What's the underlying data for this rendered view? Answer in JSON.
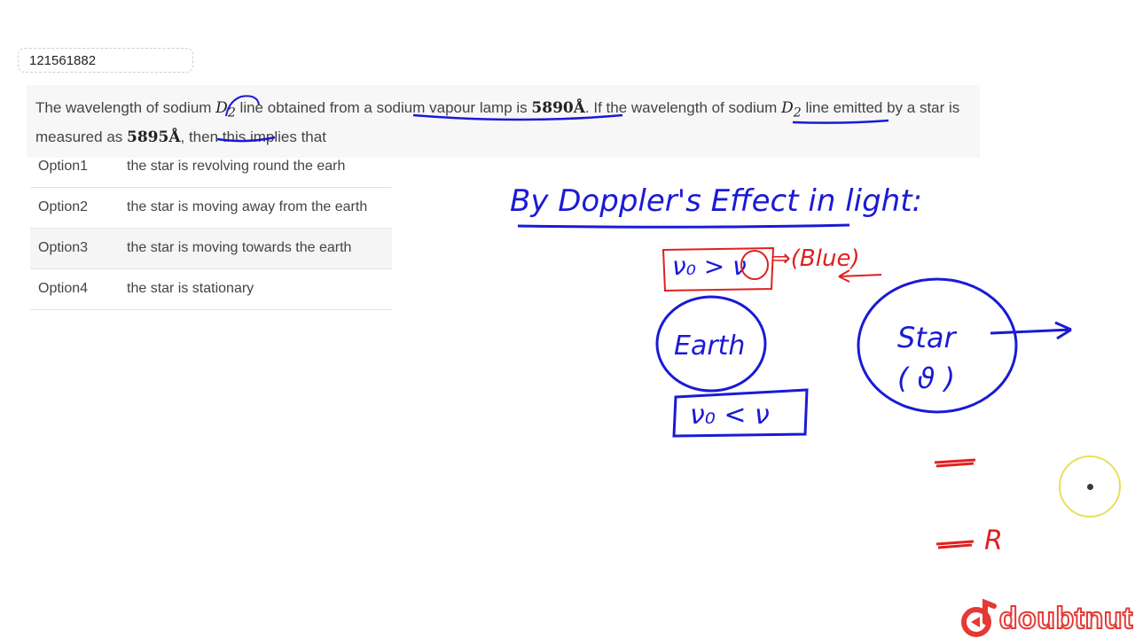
{
  "question_id": "121561882",
  "question": {
    "t1": "The wavelength of sodium ",
    "d2a_main": "D",
    "d2a_sub": "2",
    "t2": " line obtained from a ",
    "t3": "sodium vapour lamp is ",
    "val1": "5890Å",
    "t4": ". If the wavelength of ",
    "t5": "sodium ",
    "d2b_main": "D",
    "d2b_sub": "2",
    "t6": " line emitted by a star is measured as ",
    "val2": "5895Å",
    "t7": ", then this implies that"
  },
  "options": [
    {
      "key": "Option1",
      "text": "the star is revolving round the earh"
    },
    {
      "key": "Option2",
      "text": "the star is moving away from the earth"
    },
    {
      "key": "Option3",
      "text": "the star is moving towards the earth"
    },
    {
      "key": "Option4",
      "text": "the star is stationary"
    }
  ],
  "annotation": {
    "heading": "By Doppler's Effect in light:",
    "box_top": "ν₀ > ν",
    "implies_blue": "⇒(Blue)",
    "earth": "Earth",
    "star_line1": "Star",
    "star_line2": "( ϑ )",
    "box_bottom": "ν₀ < ν",
    "red_R": "R",
    "ink_blue": "#1a1ad6",
    "ink_red": "#e02020"
  },
  "brand": {
    "logo_text": "doubtnut",
    "logo_color": "#e53935"
  }
}
